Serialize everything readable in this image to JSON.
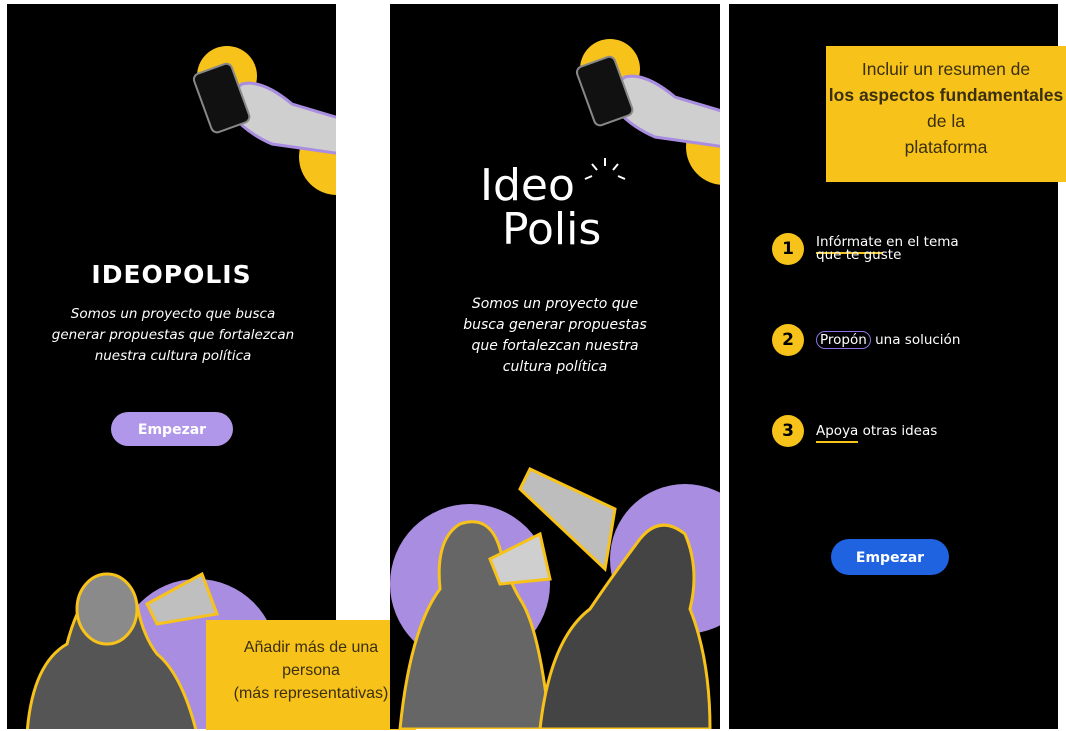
{
  "screen1": {
    "title": "IDEOPOLIS",
    "tagline_lines": [
      "Somos un proyecto que busca",
      "generar propuestas que fortalezcan",
      "nuestra cultura política"
    ],
    "button_label": "Empezar",
    "note_lines": [
      "Añadir más de una",
      "persona",
      "(más representativas)"
    ]
  },
  "screen2": {
    "logo_line1": "Ideo",
    "logo_line2": "Polis",
    "tagline_lines": [
      "Somos un proyecto que",
      "busca generar propuestas",
      "que fortalezcan nuestra",
      "cultura política"
    ]
  },
  "screen3": {
    "note_line1": "Incluir un resumen de",
    "note_bold": "los aspectos fundamentales",
    "note_tail": "de la",
    "note_last": "plataforma",
    "steps": [
      {
        "number": "1",
        "highlight": "Infórmate",
        "rest_line1": " en el tema",
        "line2": "que te guste"
      },
      {
        "number": "2",
        "highlight": "Propón",
        "rest_line1": " una solución"
      },
      {
        "number": "3",
        "highlight": "Apoya",
        "rest_line1": " otras ideas"
      }
    ],
    "button_label": "Empezar"
  },
  "colors": {
    "yellow": "#f7c21a",
    "purple": "#a98de0",
    "blue": "#1f63e0",
    "background": "#000000"
  }
}
